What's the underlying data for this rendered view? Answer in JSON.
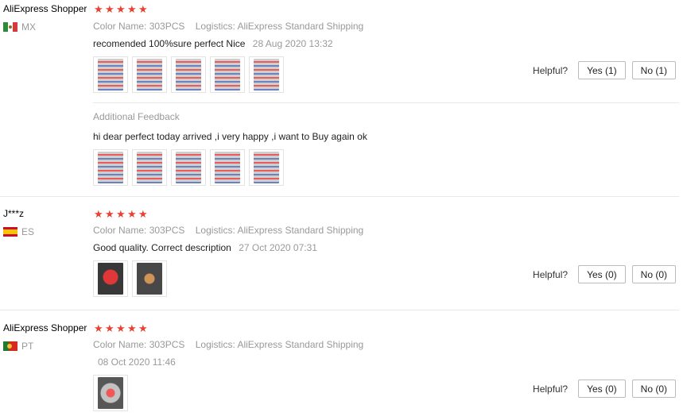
{
  "reviews": [
    {
      "user": "AliExpress Shopper",
      "country": "MX",
      "color_label": "Color Name:",
      "color_value": "303PCS",
      "logistics_label": "Logistics:",
      "logistics_value": "AliExpress Standard Shipping",
      "feedback": "recomended 100%sure perfect Nice",
      "date": "28 Aug 2020 13:32",
      "helpful_label": "Helpful?",
      "yes_label": "Yes (1)",
      "no_label": "No (1)",
      "additional_title": "Additional Feedback",
      "additional_text": "hi dear perfect today arrived ,i very happy ,i want to Buy again ok",
      "rating": 5
    },
    {
      "user": "J***z",
      "country": "ES",
      "color_label": "Color Name:",
      "color_value": "303PCS",
      "logistics_label": "Logistics:",
      "logistics_value": "AliExpress Standard Shipping",
      "feedback": "Good quality. Correct description",
      "date": "27 Oct 2020 07:31",
      "helpful_label": "Helpful?",
      "yes_label": "Yes (0)",
      "no_label": "No (0)",
      "rating": 5
    },
    {
      "user": "AliExpress Shopper",
      "country": "PT",
      "color_label": "Color Name:",
      "color_value": "303PCS",
      "logistics_label": "Logistics:",
      "logistics_value": "AliExpress Standard Shipping",
      "date": "08 Oct 2020 11:46",
      "helpful_label": "Helpful?",
      "yes_label": "Yes (0)",
      "no_label": "No (0)",
      "rating": 5
    }
  ],
  "star_glyph": "★",
  "colors": {
    "star": "#e8412f",
    "muted": "#999999"
  },
  "icons": [
    "flag-mx-icon",
    "flag-es-icon",
    "flag-pt-icon",
    "star-icon"
  ]
}
